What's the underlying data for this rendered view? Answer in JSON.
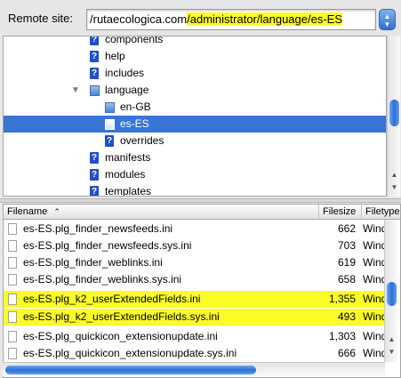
{
  "remote": {
    "label": "Remote site:",
    "path_plain": "/rutaecologica.com",
    "path_highlight": "/administrator/language/es-ES"
  },
  "tree": {
    "items": [
      {
        "label": "components",
        "icon": "question-folder-icon"
      },
      {
        "label": "help",
        "icon": "question-folder-icon"
      },
      {
        "label": "includes",
        "icon": "question-folder-icon"
      },
      {
        "label": "language",
        "icon": "folder-icon",
        "expanded": true
      },
      {
        "label": "en-GB",
        "icon": "folder-icon"
      },
      {
        "label": "es-ES",
        "icon": "folder-icon",
        "selected": true
      },
      {
        "label": "overrides",
        "icon": "question-folder-icon"
      },
      {
        "label": "manifests",
        "icon": "question-folder-icon"
      },
      {
        "label": "modules",
        "icon": "question-folder-icon"
      },
      {
        "label": "templates",
        "icon": "question-folder-icon"
      }
    ]
  },
  "list": {
    "headers": {
      "filename": "Filename",
      "filesize": "Filesize",
      "filetype": "Filetype"
    },
    "rows": [
      {
        "name": "es-ES.plg_finder_newsfeeds.ini",
        "size": "662",
        "type": "Wind"
      },
      {
        "name": "es-ES.plg_finder_newsfeeds.sys.ini",
        "size": "703",
        "type": "Wind"
      },
      {
        "name": "es-ES.plg_finder_weblinks.ini",
        "size": "619",
        "type": "Wind"
      },
      {
        "name": "es-ES.plg_finder_weblinks.sys.ini",
        "size": "658",
        "type": "Wind"
      },
      {
        "name": "es-ES.plg_k2_userExtendedFields.ini",
        "size": "1,355",
        "type": "Wind",
        "highlight": true
      },
      {
        "name": "es-ES.plg_k2_userExtendedFields.sys.ini",
        "size": "493",
        "type": "Wind",
        "highlight": true
      },
      {
        "name": "es-ES.plg_quickicon_extensionupdate.ini",
        "size": "1,303",
        "type": "Wind"
      },
      {
        "name": "es-ES.plg_quickicon_extensionupdate.sys.ini",
        "size": "666",
        "type": "Wind"
      }
    ]
  },
  "colors": {
    "selection": "#3875d7",
    "highlight": "#fbfb28",
    "scroll_thumb": "#2c6fd5"
  }
}
